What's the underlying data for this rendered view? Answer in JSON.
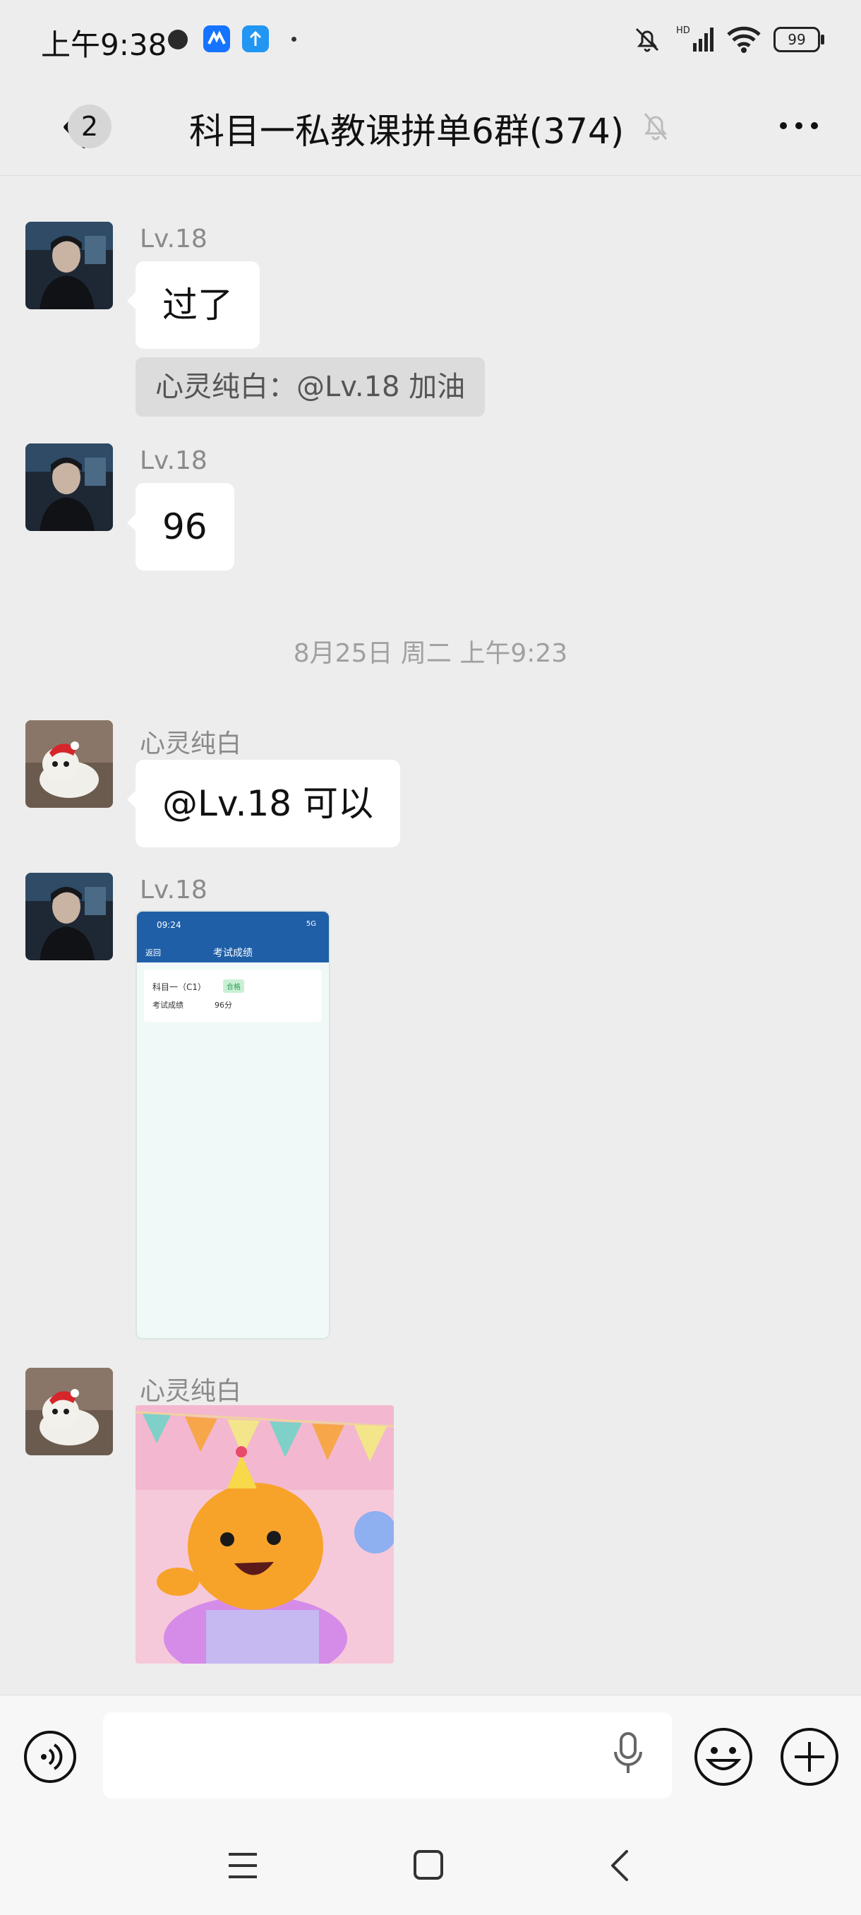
{
  "status_bar": {
    "time": "上午9:38",
    "network": "HD",
    "battery": "99"
  },
  "header": {
    "unread_count": "2",
    "title": "科目一私教课拼单6群(374)"
  },
  "messages": [
    {
      "sender": "Lv.18",
      "text": "过了"
    },
    {
      "quote": "心灵纯白：@Lv.18 加油"
    },
    {
      "sender": "Lv.18",
      "text": "96"
    },
    {
      "timestamp": "8月25日 周二 上午9:23"
    },
    {
      "sender": "心灵纯白",
      "text": "@Lv.18  可以"
    },
    {
      "sender": "Lv.18",
      "image": {
        "time": "09:24",
        "signal": "5G",
        "back": "返回",
        "title": "考试成绩",
        "subject": "科目一（C1）",
        "status": "合格",
        "score_label": "考试成绩",
        "score": "96分"
      }
    },
    {
      "sender": "心灵纯白",
      "sticker": "party-sticker"
    }
  ],
  "colors": {
    "background": "#ededed",
    "bubble": "#ffffff",
    "app_blue": "#1f5fa8"
  }
}
